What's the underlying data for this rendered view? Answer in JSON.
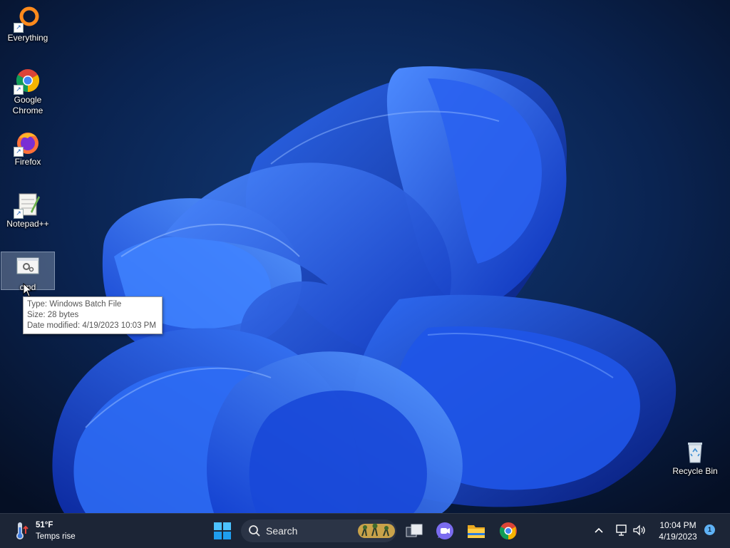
{
  "desktop": {
    "icons": [
      {
        "label_line1": "Everything",
        "label_line2": "",
        "icon": "everything-icon"
      },
      {
        "label_line1": "Google",
        "label_line2": "Chrome",
        "icon": "chrome-icon"
      },
      {
        "label_line1": "Firefox",
        "label_line2": "",
        "icon": "firefox-icon"
      },
      {
        "label_line1": "Notepad++",
        "label_line2": "",
        "icon": "notepadpp-icon"
      },
      {
        "label_line1": "cmd",
        "label_line2": "",
        "icon": "batch-file-icon",
        "selected": true
      },
      {
        "label_line1": "Recycle Bin",
        "label_line2": "",
        "icon": "recycle-bin-icon"
      }
    ],
    "tooltip": {
      "type": "Type: Windows Batch File",
      "size": "Size: 28 bytes",
      "modified": "Date modified: 4/19/2023 10:03 PM"
    }
  },
  "taskbar": {
    "weather": {
      "temp": "51°F",
      "condition": "Temps rise",
      "icon": "thermometer-icon"
    },
    "search": {
      "label": "Search",
      "icon": "search-icon"
    },
    "pinned": [
      "start-icon",
      "task-view-icon",
      "teams-chat-icon",
      "file-explorer-icon",
      "chrome-icon"
    ],
    "tray_icons": [
      "chevron-up-icon",
      "network-icon",
      "volume-icon"
    ],
    "clock": {
      "time": "10:04 PM",
      "date": "4/19/2023"
    },
    "notification_count": "1"
  },
  "colors": {
    "accent": "#1f6fe0",
    "taskbar": "#1c2536",
    "wallpaper_dark": "#07142e"
  }
}
